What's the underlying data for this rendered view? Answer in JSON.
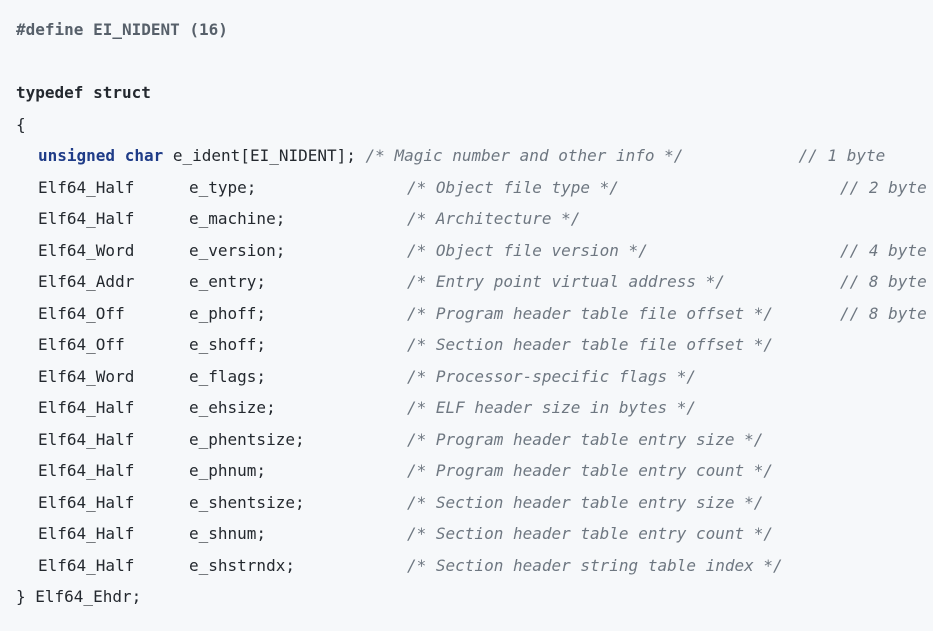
{
  "code": {
    "define_line": "#define EI_NIDENT (16)",
    "typedef_line": "typedef struct",
    "open_brace": "{",
    "ident_field": {
      "type_keyword": "unsigned char",
      "field": "e_ident[EI_NIDENT];",
      "comment": "/* Magic number and other info */",
      "trailing_comment": "// 1 byte"
    },
    "fields": [
      {
        "type": "Elf64_Half",
        "field": "e_type;",
        "comment": "/* Object file type */",
        "trailing_comment": "// 2 byte"
      },
      {
        "type": "Elf64_Half",
        "field": "e_machine;",
        "comment": "/* Architecture */",
        "trailing_comment": ""
      },
      {
        "type": "Elf64_Word",
        "field": "e_version;",
        "comment": "/* Object file version */",
        "trailing_comment": "// 4 byte"
      },
      {
        "type": "Elf64_Addr",
        "field": "e_entry;",
        "comment": "/* Entry point virtual address */",
        "trailing_comment": "// 8 byte"
      },
      {
        "type": "Elf64_Off",
        "field": "e_phoff;",
        "comment": "/* Program header table file offset */",
        "trailing_comment": "// 8 byte"
      },
      {
        "type": "Elf64_Off",
        "field": "e_shoff;",
        "comment": "/* Section header table file offset */",
        "trailing_comment": ""
      },
      {
        "type": "Elf64_Word",
        "field": "e_flags;",
        "comment": "/* Processor-specific flags */",
        "trailing_comment": ""
      },
      {
        "type": "Elf64_Half",
        "field": "e_ehsize;",
        "comment": "/* ELF header size in bytes */",
        "trailing_comment": ""
      },
      {
        "type": "Elf64_Half",
        "field": "e_phentsize;",
        "comment": "/* Program header table entry size */",
        "trailing_comment": ""
      },
      {
        "type": "Elf64_Half",
        "field": "e_phnum;",
        "comment": "/* Program header table entry count */",
        "trailing_comment": ""
      },
      {
        "type": "Elf64_Half",
        "field": "e_shentsize;",
        "comment": "/* Section header table entry size */",
        "trailing_comment": ""
      },
      {
        "type": "Elf64_Half",
        "field": "e_shnum;",
        "comment": "/* Section header table entry count */",
        "trailing_comment": ""
      },
      {
        "type": "Elf64_Half",
        "field": "e_shstrndx;",
        "comment": "/* Section header string table index */",
        "trailing_comment": ""
      }
    ],
    "close_line": "} Elf64_Ehdr;"
  }
}
